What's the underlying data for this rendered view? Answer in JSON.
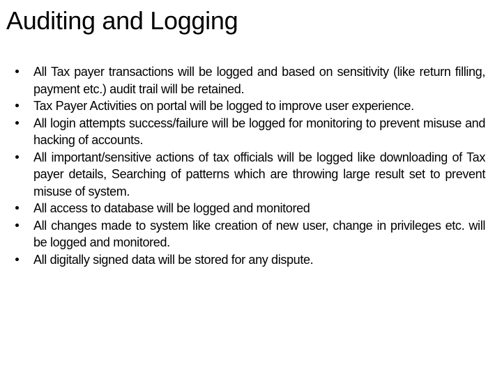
{
  "slide": {
    "title": "Auditing and Logging",
    "bullets": [
      "All Tax payer transactions will be logged and based on sensitivity (like return filling, payment etc.) audit trail will be retained.",
      "Tax Payer Activities on portal will be logged to improve user experience.",
      "All login attempts success/failure will be logged for monitoring to prevent misuse and hacking of accounts.",
      "All important/sensitive actions of tax officials will be logged like downloading of Tax payer details, Searching of patterns which are throwing large result set to prevent misuse of system.",
      "All access to database will be logged and monitored",
      "All changes made to system like creation of new user, change in privileges etc. will be logged and monitored.",
      "All digitally signed data will be stored for any dispute."
    ],
    "bullet_icon": "bullet-dot",
    "colors": {
      "background": "#ffffff",
      "text": "#000000"
    }
  }
}
